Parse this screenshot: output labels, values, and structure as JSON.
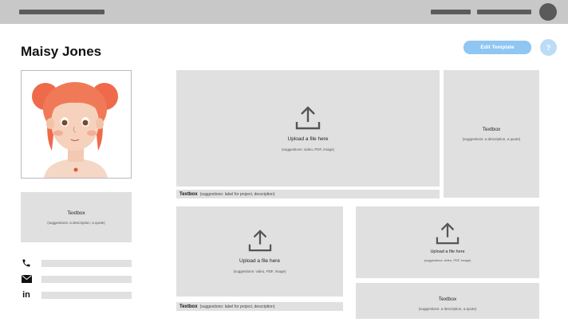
{
  "profile": {
    "name": "Maisy Jones",
    "textbox_title": "Textbox",
    "textbox_sub": "(suggestions: a description, a quote)"
  },
  "header": {
    "edit_label": "Edit Template",
    "help_label": "?"
  },
  "upload_large": {
    "title": "Upload a file here",
    "sub": "(suggestions: video, PDF, image)"
  },
  "caption_1": {
    "bold": "Textbox",
    "rest": "(suggestions: label for project, description)"
  },
  "textbox_right_top": {
    "title": "Textbox",
    "sub": "(suggestions: a description, a quote)"
  },
  "upload_mid": {
    "title": "Upload a file here",
    "sub": "(suggestions: video, PDF, image)"
  },
  "caption_2": {
    "bold": "Textbox",
    "rest": "(suggestions: label for project, description)"
  },
  "upload_right": {
    "title": "Upload a file here",
    "sub": "(suggestions: video, PDF, image)"
  },
  "textbox_right_bottom": {
    "title": "Textbox",
    "sub": "(suggestions: a description, a quote)"
  },
  "contacts": [
    {
      "icon": "phone-icon"
    },
    {
      "icon": "mail-icon"
    },
    {
      "icon": "linkedin-icon"
    }
  ],
  "colors": {
    "accent": "#8fc6f2",
    "panel": "#e0e0e0",
    "topbar": "#c8c8c8"
  }
}
